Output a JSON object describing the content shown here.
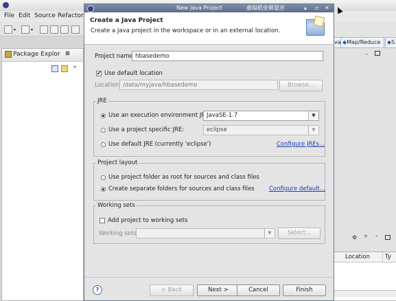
{
  "background": {
    "menu": [
      "File",
      "Edit",
      "Source",
      "Refactor"
    ],
    "package_explorer_title": "Package Explor",
    "perspective_partial": "va",
    "perspective_mapreduce": "Map/Reduce",
    "perspective_trailing": "S",
    "location_column": "Location",
    "partial_column": "Ty"
  },
  "dialog": {
    "window_title": "New Java Project",
    "overlay_text": "虚拟机全屏显示",
    "heading": "Create a Java Project",
    "description": "Create a Java project in the workspace or in an external location.",
    "project_name_label": "Project name:",
    "project_name_value": "hbasedemo",
    "use_default_location_label": "Use default location",
    "use_default_location_checked": true,
    "location_label": "Location:",
    "location_value": "/data/myjava/hbasedemo",
    "browse_label": "Browse...",
    "jre": {
      "group_label": "JRE",
      "option_env_label": "Use an execution environment JRE:",
      "option_env_value": "JavaSE-1.7",
      "option_specific_label": "Use a project specific JRE:",
      "option_specific_value": "eclipse",
      "option_default_label": "Use default JRE (currently 'eclipse')",
      "configure_link": "Configure JREs...",
      "selected": "env"
    },
    "layout": {
      "group_label": "Project layout",
      "option_root_label": "Use project folder as root for sources and class files",
      "option_separate_label": "Create separate folders for sources and class files",
      "configure_link": "Configure default...",
      "selected": "separate"
    },
    "working_sets": {
      "group_label": "Working sets",
      "add_label": "Add project to working sets",
      "add_checked": false,
      "working_sets_label": "Working sets:",
      "working_sets_value": "",
      "select_label": "Select..."
    },
    "buttons": {
      "back": "< Back",
      "next": "Next >",
      "cancel": "Cancel",
      "finish": "Finish"
    },
    "help_icon_glyph": "?"
  },
  "colors": {
    "title_bar": "#5b6d88",
    "link": "#1a3fb8",
    "dialog_bg": "#e4e4e4"
  }
}
